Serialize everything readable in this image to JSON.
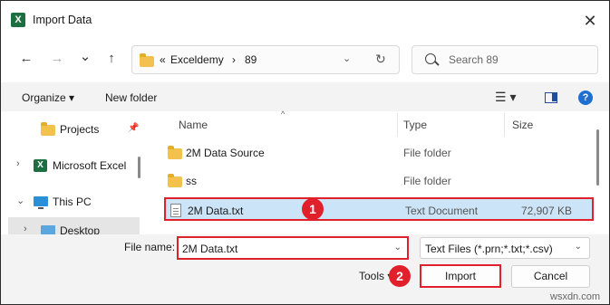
{
  "window": {
    "title": "Import Data",
    "close": "✕"
  },
  "nav": {
    "back": "←",
    "forward": "→",
    "recent": "⌄",
    "up": "↑",
    "breadcrumb": [
      "«",
      "Exceldemy",
      "›",
      "89"
    ],
    "address_dropdown": "⌄",
    "refresh": "↻",
    "search_placeholder": "Search 89"
  },
  "toolbar": {
    "organize": "Organize ▾",
    "new_folder": "New folder",
    "view": "☰ ▾",
    "help": "?"
  },
  "nav_pane": [
    {
      "label": "Projects",
      "icon": "folder-icon",
      "pinned": true
    },
    {
      "label": "Microsoft Excel",
      "icon": "excel-icon",
      "expand": "›"
    },
    {
      "label": "This PC",
      "icon": "computer-icon",
      "expand": "⌄"
    },
    {
      "label": "Desktop",
      "icon": "desktop-icon",
      "expand": "›"
    }
  ],
  "columns": {
    "name": "Name",
    "type": "Type",
    "size": "Size",
    "sort": "^"
  },
  "files": [
    {
      "name": "2M Data Source",
      "type": "File folder",
      "size": "",
      "icon": "folder-icon"
    },
    {
      "name": "ss",
      "type": "File folder",
      "size": "",
      "icon": "folder-icon"
    },
    {
      "name": "2M Data.txt",
      "type": "Text Document",
      "size": "72,907 KB",
      "icon": "text-file-icon",
      "selected": true
    }
  ],
  "bottom": {
    "file_name_label": "File name:",
    "file_name_value": "2M Data.txt",
    "file_type": "Text Files (*.prn;*.txt;*.csv)",
    "tools": "Tools ▾",
    "import": "Import",
    "cancel": "Cancel"
  },
  "badges": {
    "one": "1",
    "two": "2"
  },
  "watermark": "wsxdn.com",
  "colors": {
    "highlight": "#e0202a",
    "selection": "#cce4f7",
    "excel": "#1d6f42",
    "folder": "#f2c14e"
  }
}
